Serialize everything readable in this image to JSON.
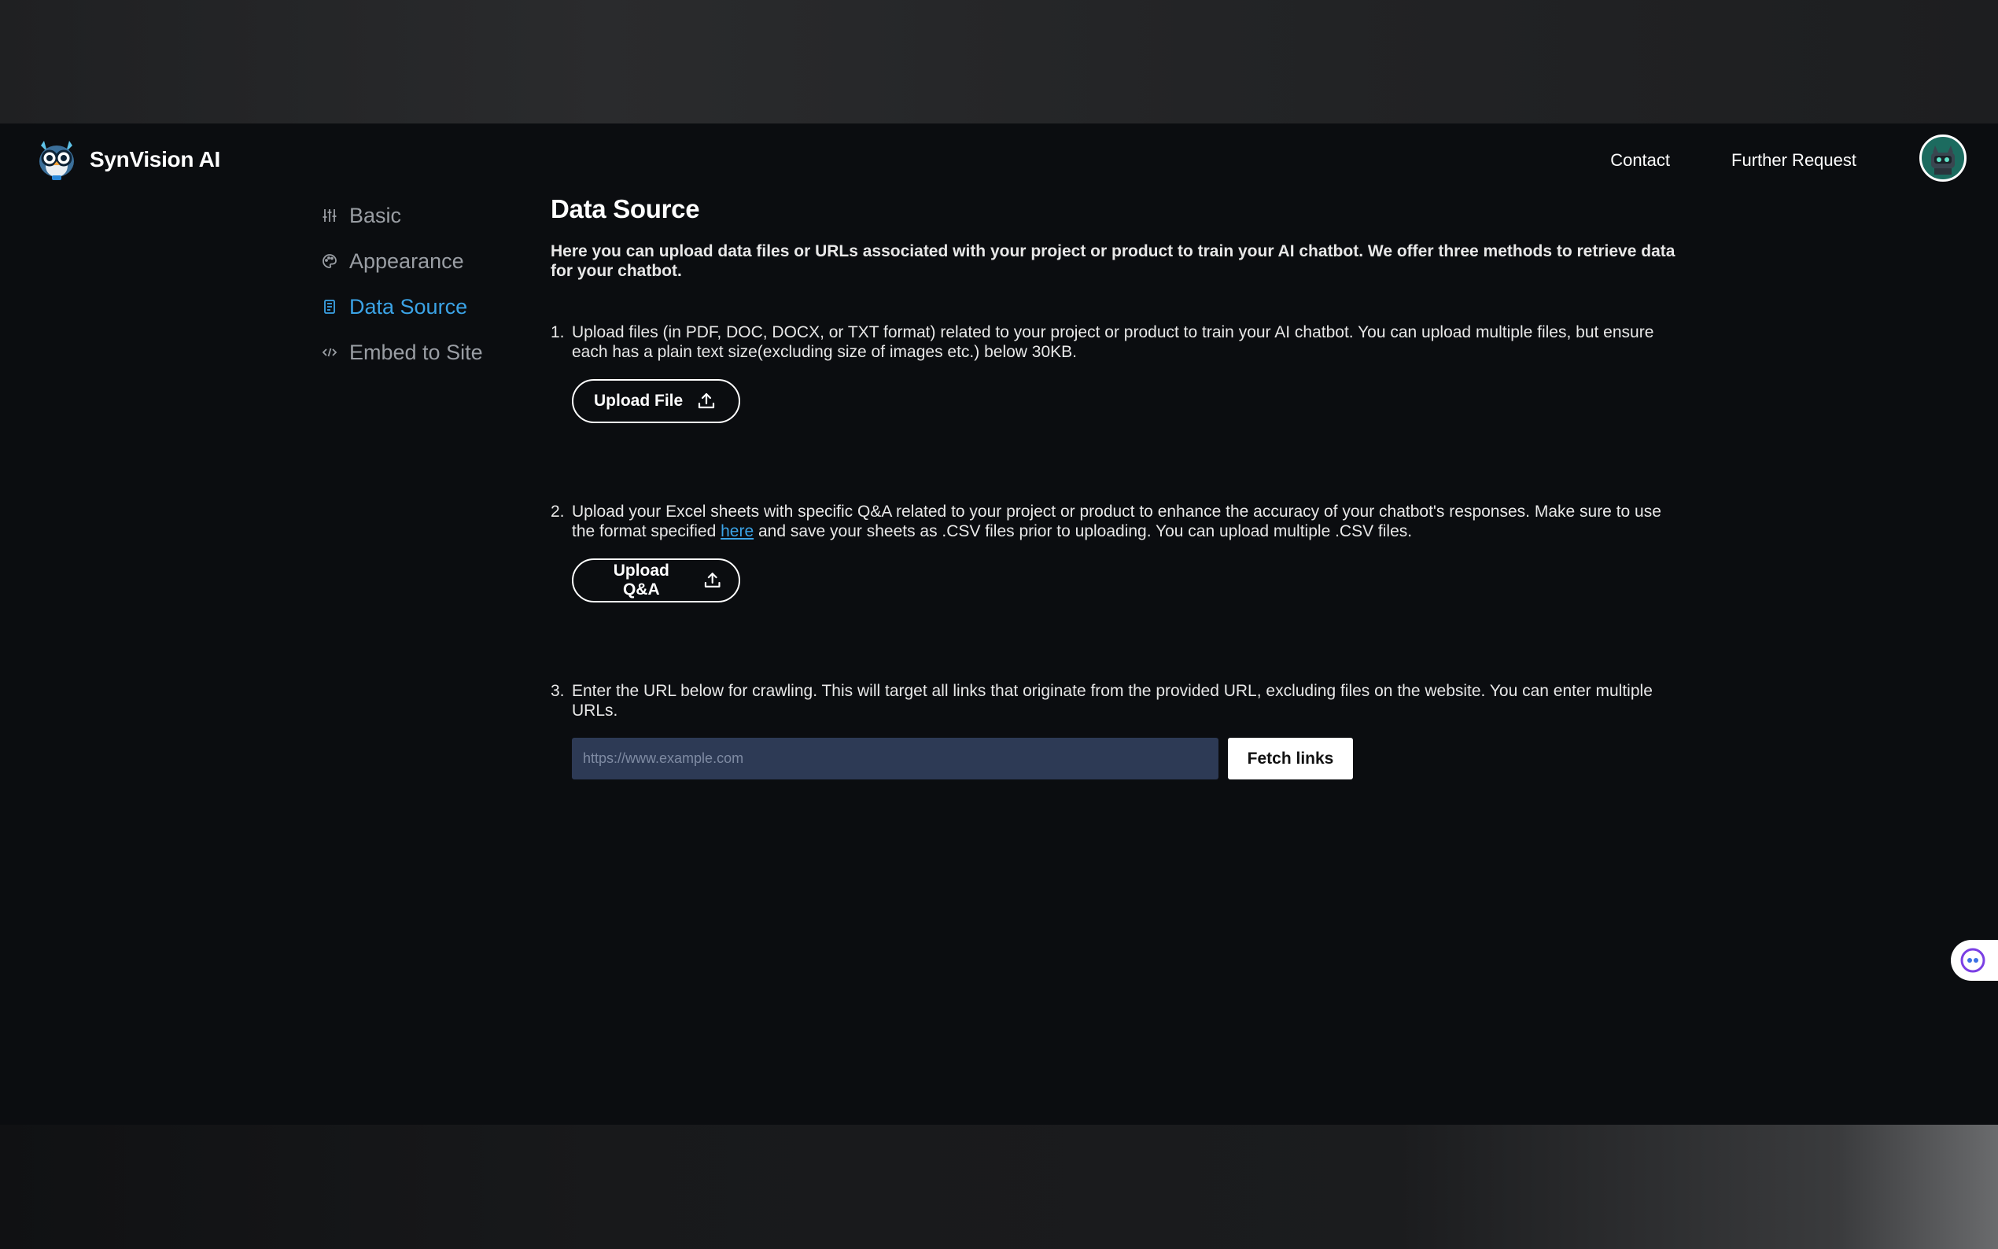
{
  "header": {
    "brand_name": "SynVision AI",
    "nav": [
      {
        "label": "Contact"
      },
      {
        "label": "Further Request"
      }
    ]
  },
  "sidebar": {
    "items": [
      {
        "label": "Basic",
        "icon": "sliders-icon",
        "active": false
      },
      {
        "label": "Appearance",
        "icon": "palette-icon",
        "active": false
      },
      {
        "label": "Data Source",
        "icon": "document-icon",
        "active": true
      },
      {
        "label": "Embed to Site",
        "icon": "code-icon",
        "active": false
      }
    ]
  },
  "main": {
    "title": "Data Source",
    "intro": "Here you can upload data files or URLs associated with your project or product to train your AI chatbot. We offer three methods to retrieve data for your chatbot.",
    "steps": [
      {
        "num": "1.",
        "text": "Upload files (in PDF, DOC, DOCX, or TXT format) related to your project or product to train your AI chatbot. You can upload multiple files, but ensure each has a plain text size(excluding size of images etc.) below 30KB.",
        "button_label": "Upload File"
      },
      {
        "num": "2.",
        "text_before": "Upload your Excel sheets with specific Q&A related to your project or product to enhance the accuracy of your chatbot's responses. Make sure to use the format specified ",
        "link_text": "here",
        "text_after": " and save your sheets as .CSV files prior to uploading. You can upload multiple .CSV files.",
        "button_label": "Upload Q&A"
      },
      {
        "num": "3.",
        "text": "Enter the URL below for crawling. This will target all links that originate from the provided URL, excluding files on the website. You can enter multiple URLs.",
        "input_placeholder": "https://www.example.com",
        "input_value": "",
        "button_label": "Fetch links"
      }
    ]
  },
  "colors": {
    "background": "#0b0d10",
    "accent": "#3ba3e6",
    "input_bg": "#2d3a55"
  }
}
